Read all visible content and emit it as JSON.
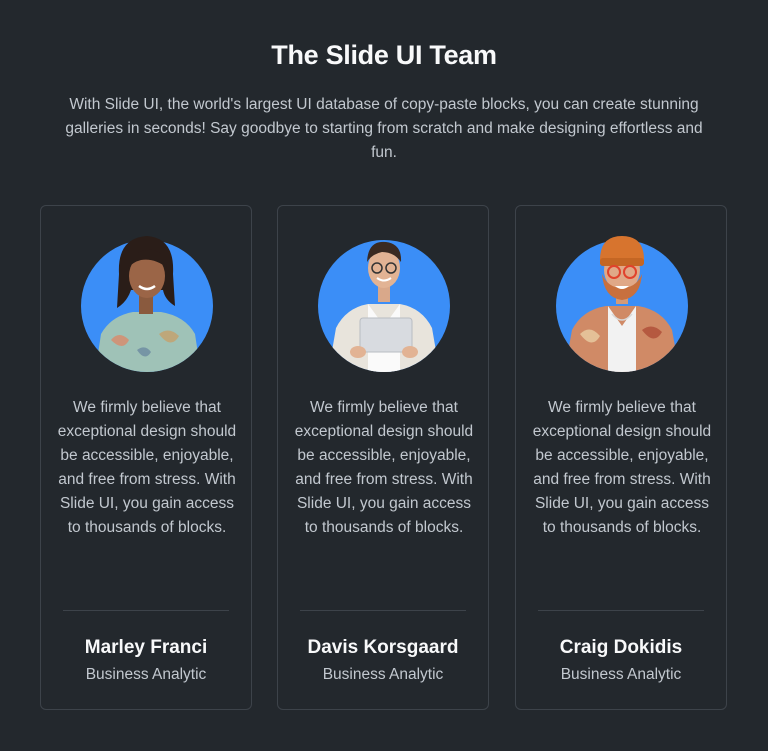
{
  "header": {
    "title": "The Slide UI Team",
    "subtitle": "With Slide UI, the world's largest UI database of copy-paste blocks, you can create stunning galleries in seconds! Say goodbye to starting from scratch and make designing effortless and fun."
  },
  "colors": {
    "background": "#23282d",
    "card_border": "#3d434a",
    "avatar_circle": "#3b8ef7",
    "heading": "#f8f9fa",
    "body_text": "#c2c8cf"
  },
  "team": [
    {
      "avatar_icon": "person-avatar-icon",
      "quote": "We firmly believe that exceptional design should be accessible, enjoyable, and free from stress. With Slide UI, you gain access to thousands of blocks.",
      "name": "Marley Franci",
      "role": "Business Analytic"
    },
    {
      "avatar_icon": "person-avatar-icon",
      "quote": "We firmly believe that exceptional design should be accessible, enjoyable, and free from stress. With Slide UI, you gain access to thousands of blocks.",
      "name": "Davis Korsgaard",
      "role": "Business Analytic"
    },
    {
      "avatar_icon": "person-avatar-icon",
      "quote": "We firmly believe that exceptional design should be accessible, enjoyable, and free from stress. With Slide UI, you gain access to thousands of blocks.",
      "name": "Craig Dokidis",
      "role": "Business Analytic"
    }
  ]
}
